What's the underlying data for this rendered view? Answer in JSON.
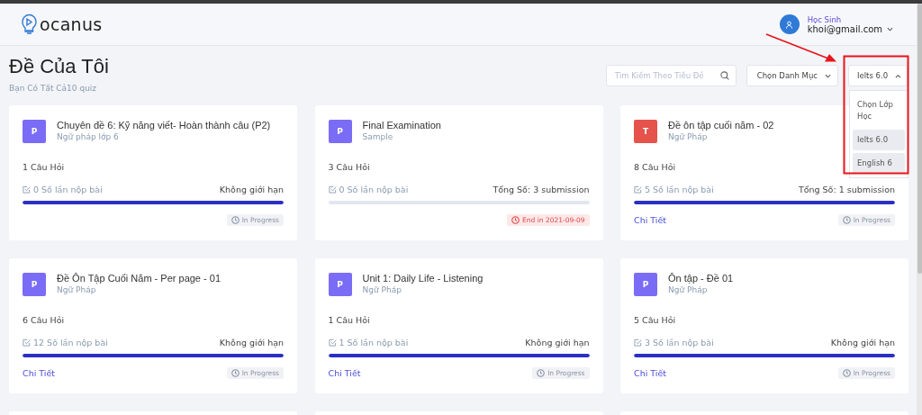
{
  "header": {
    "logo": "ocanus",
    "user": {
      "role": "Học Sinh",
      "email": "khoi@gmail.com"
    }
  },
  "page": {
    "title": "Đề Của Tôi",
    "subtitle": "Bạn Có Tất Cả10 quiz"
  },
  "filters": {
    "search": {
      "placeholder": "Tìm Kiếm Theo Tiêu Đề"
    },
    "category": {
      "label": "Chọn Danh Mục"
    },
    "class_select": {
      "value": "Ielts 6.0",
      "expanded": true,
      "options": [
        {
          "label": "Chọn Lớp Học",
          "highlighted": false
        },
        {
          "label": "Ielts 6.0",
          "highlighted": true
        },
        {
          "label": "English 6",
          "highlighted": true
        }
      ]
    }
  },
  "quizzes": [
    {
      "letter": "P",
      "color": "#7b6cf6",
      "title": "Chuyên đề 6: Kỹ năng viết- Hoàn thành câu (P2)",
      "subtitle": "Ngữ pháp lớp 6",
      "questions": "1 Câu Hỏi",
      "submissions": "0 Số lần nộp bài",
      "limit": "Không giới hạn",
      "level": 1,
      "status": {
        "kind": "progress",
        "label": "In Progress"
      }
    },
    {
      "letter": "P",
      "color": "#7b6cf6",
      "title": "Final Examination",
      "subtitle": "Sample",
      "questions": "3 Câu Hỏi",
      "submissions": "0 Số lần nộp bài",
      "limit": "Tổng Số: 3 submission",
      "level": 0,
      "status": {
        "kind": "ended",
        "label": "End in 2021-09-09"
      }
    },
    {
      "letter": "T",
      "color": "#e5534b",
      "title": "Đề ôn tập cuối năm - 02",
      "subtitle": "Ngữ Pháp",
      "questions": "8 Câu Hỏi",
      "submissions": "5 Số lần nộp bài",
      "limit": "Tổng Số: 1 submission",
      "level": 1,
      "link": "Chi Tiết",
      "status": {
        "kind": "progress",
        "label": "In Progress"
      }
    },
    {
      "letter": "P",
      "color": "#7b6cf6",
      "title": "Đề Ôn Tập Cuối Năm - Per page - 01",
      "subtitle": "Ngữ Pháp",
      "questions": "6 Câu Hỏi",
      "submissions": "12 Số lần nộp bài",
      "limit": "Không giới hạn",
      "level": 1,
      "link": "Chi Tiết",
      "status": {
        "kind": "progress",
        "label": "In Progress"
      }
    },
    {
      "letter": "P",
      "color": "#7b6cf6",
      "title": "Unit 1: Daily Life - Listening",
      "subtitle": "Ngữ Pháp",
      "questions": "1 Câu Hỏi",
      "submissions": "1 Số lần nộp bài",
      "limit": "Không giới hạn",
      "level": 1,
      "link": "Chi Tiết",
      "status": {
        "kind": "progress",
        "label": "In Progress"
      }
    },
    {
      "letter": "P",
      "color": "#7b6cf6",
      "title": "Ôn tập - Đề 01",
      "subtitle": "Ngữ Pháp",
      "questions": "5 Câu Hỏi",
      "submissions": "3 Số lần nộp bài",
      "limit": "Không giới hạn",
      "level": 1,
      "link": "Chi Tiết",
      "status": {
        "kind": "progress",
        "label": "In Progress"
      }
    }
  ]
}
